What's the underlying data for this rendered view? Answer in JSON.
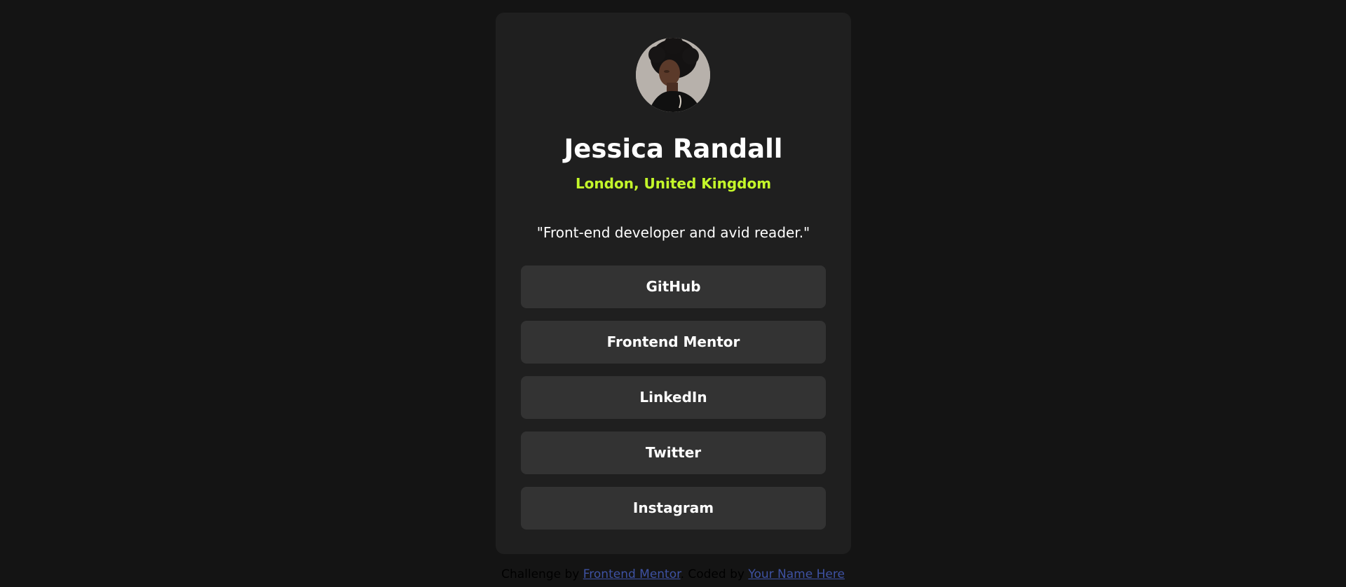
{
  "profile": {
    "avatar_icon": "profile-photo",
    "name": "Jessica Randall",
    "location": "London, United Kingdom",
    "bio": "\"Front-end developer and avid reader.\""
  },
  "links": [
    {
      "label": "GitHub"
    },
    {
      "label": "Frontend Mentor"
    },
    {
      "label": "LinkedIn"
    },
    {
      "label": "Twitter"
    },
    {
      "label": "Instagram"
    }
  ],
  "attribution": {
    "prefix": "Challenge by",
    "challenge_link": "Frontend Mentor",
    "middle": ". Coded by",
    "author_link": "Your Name Here"
  },
  "colors": {
    "page_background": "#141414",
    "card_background": "#1f1f1f",
    "button_background": "#333333",
    "accent": "#c4f82a",
    "text": "#ffffff",
    "link": "#3e52a3"
  }
}
